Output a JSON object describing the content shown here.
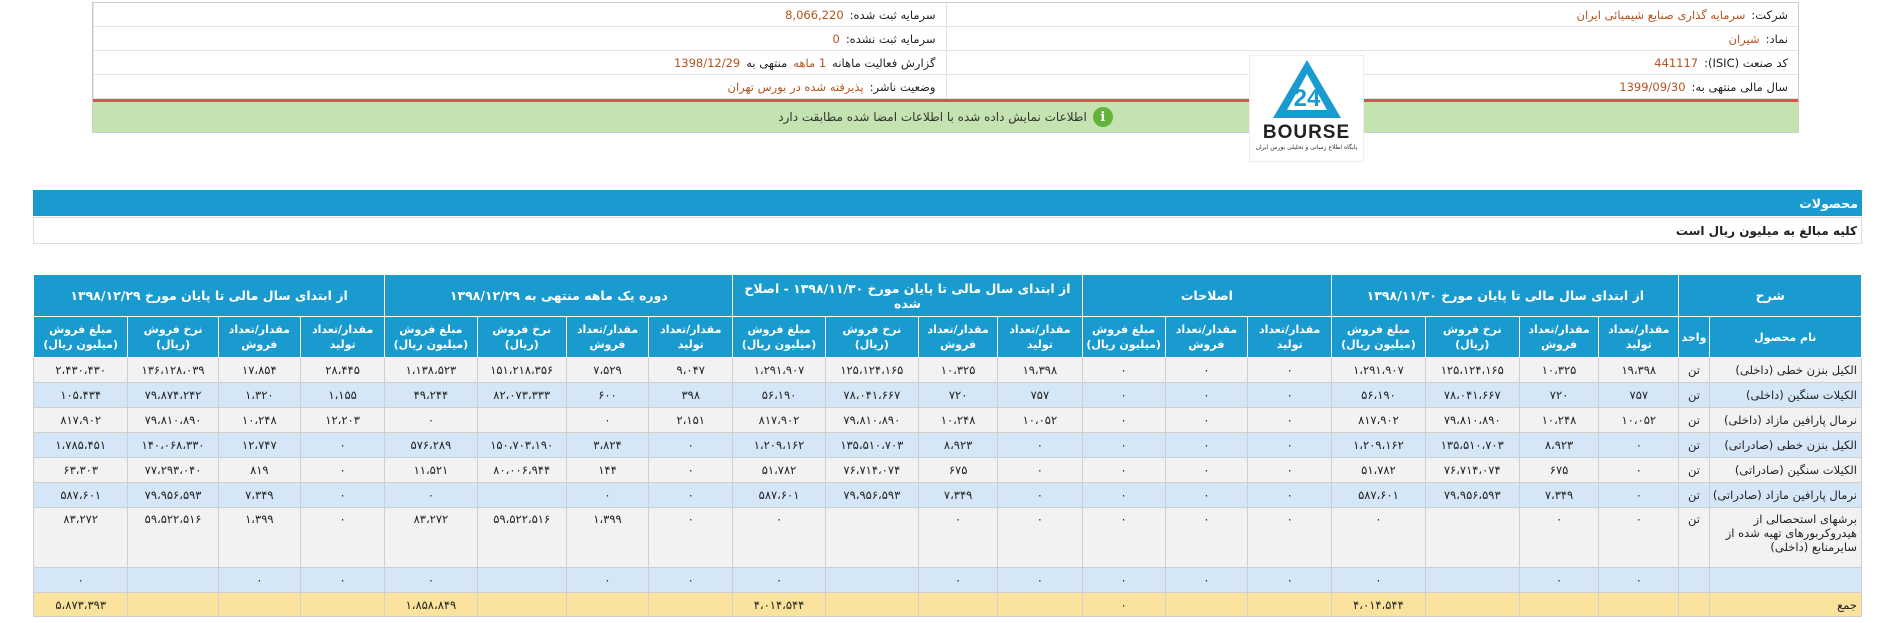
{
  "info": {
    "company_label": "شرکت:",
    "company_value": "سرمایه گذاری صنایع شیمیائی ایران",
    "capital_reg_label": "سرمایه ثبت شده:",
    "capital_reg_value": "8,066,220",
    "symbol_label": "نماد:",
    "symbol_value": "شیران",
    "capital_unreg_label": "سرمایه ثبت نشده:",
    "capital_unreg_value": "0",
    "isic_label": "کد صنعت (ISIC):",
    "isic_value": "441117",
    "report_label": "گزارش فعالیت ماهانه",
    "report_months": "1 ماهه",
    "report_mid": "منتهی به",
    "report_date": "1398/12/29",
    "fy_label": "سال مالی منتهی به:",
    "fy_value": "1399/09/30",
    "publisher_label": "وضعیت ناشر:",
    "publisher_value": "پذیرفته شده در بورس تهران",
    "banner_text": "اطلاعات نمایش داده شده با اطلاعات امضا شده مطابقت دارد",
    "banner_icon": "i"
  },
  "logo": {
    "text": "BOURSE",
    "sub": "پایگاه اطلاع رسانی و تحلیلی بورس ایران",
    "digits": "24"
  },
  "section": {
    "title": "محصولات",
    "note": "کلیه مبالغ به میلیون ریال است"
  },
  "table": {
    "groups": [
      "شرح",
      "از ابتدای سال مالی تا پایان مورخ ۱۳۹۸/۱۱/۳۰",
      "اصلاحات",
      "از ابتدای سال مالی تا پایان مورخ ۱۳۹۸/۱۱/۳۰ - اصلاح شده",
      "دوره یک ماهه منتهی به ۱۳۹۸/۱۲/۲۹",
      "از ابتدای سال مالی تا پایان مورخ ۱۳۹۸/۱۲/۲۹"
    ],
    "desc_cols": [
      "نام محصول",
      "واحد"
    ],
    "sub4": [
      "مقدار/تعداد تولید",
      "مقدار/تعداد فروش",
      "نرخ فروش (ریال)",
      "مبلغ فروش (میلیون ریال)"
    ],
    "sub3": [
      "مقدار/تعداد تولید",
      "مقدار/تعداد فروش",
      "مبلغ فروش (میلیون ریال)"
    ],
    "rows": [
      {
        "name": "الکیل بنزن خطی (داخلی)",
        "unit": "تن",
        "cells": [
          "۱۹،۳۹۸",
          "۱۰،۳۲۵",
          "۱۲۵،۱۲۴،۱۶۵",
          "۱،۲۹۱،۹۰۷",
          "۰",
          "۰",
          "۰",
          "۱۹،۳۹۸",
          "۱۰،۳۲۵",
          "۱۲۵،۱۲۴،۱۶۵",
          "۱،۲۹۱،۹۰۷",
          "۹،۰۴۷",
          "۷،۵۲۹",
          "۱۵۱،۲۱۸،۳۵۶",
          "۱،۱۳۸،۵۲۳",
          "۲۸،۴۴۵",
          "۱۷،۸۵۴",
          "۱۳۶،۱۲۸،۰۳۹",
          "۲،۴۳۰،۴۳۰"
        ]
      },
      {
        "name": "الکیلات سنگین (داخلی)",
        "unit": "تن",
        "cells": [
          "۷۵۷",
          "۷۲۰",
          "۷۸،۰۴۱،۶۶۷",
          "۵۶،۱۹۰",
          "۰",
          "۰",
          "۰",
          "۷۵۷",
          "۷۲۰",
          "۷۸،۰۴۱،۶۶۷",
          "۵۶،۱۹۰",
          "۳۹۸",
          "۶۰۰",
          "۸۲،۰۷۳،۳۳۳",
          "۴۹،۲۴۴",
          "۱،۱۵۵",
          "۱،۳۲۰",
          "۷۹،۸۷۴،۲۴۲",
          "۱۰۵،۴۳۴"
        ]
      },
      {
        "name": "نرمال پارافین مازاد (داخلی)",
        "unit": "تن",
        "cells": [
          "۱۰،۰۵۲",
          "۱۰،۲۴۸",
          "۷۹،۸۱۰،۸۹۰",
          "۸۱۷،۹۰۲",
          "۰",
          "۰",
          "۰",
          "۱۰،۰۵۲",
          "۱۰،۲۴۸",
          "۷۹،۸۱۰،۸۹۰",
          "۸۱۷،۹۰۲",
          "۲،۱۵۱",
          "۰",
          "",
          "۰",
          "۱۲،۲۰۳",
          "۱۰،۲۴۸",
          "۷۹،۸۱۰،۸۹۰",
          "۸۱۷،۹۰۲"
        ]
      },
      {
        "name": "الکیل بنزن خطی (صادراتی)",
        "unit": "تن",
        "cells": [
          "۰",
          "۸،۹۲۳",
          "۱۳۵،۵۱۰،۷۰۳",
          "۱،۲۰۹،۱۶۲",
          "۰",
          "۰",
          "۰",
          "۰",
          "۸،۹۲۳",
          "۱۳۵،۵۱۰،۷۰۳",
          "۱،۲۰۹،۱۶۲",
          "۰",
          "۳،۸۲۴",
          "۱۵۰،۷۰۳،۱۹۰",
          "۵۷۶،۲۸۹",
          "۰",
          "۱۲،۷۴۷",
          "۱۴۰،۰۶۸،۳۳۰",
          "۱،۷۸۵،۴۵۱"
        ]
      },
      {
        "name": "الکیلات سنگین (صادراتی)",
        "unit": "تن",
        "cells": [
          "۰",
          "۶۷۵",
          "۷۶،۷۱۴،۰۷۴",
          "۵۱،۷۸۲",
          "۰",
          "۰",
          "۰",
          "۰",
          "۶۷۵",
          "۷۶،۷۱۴،۰۷۴",
          "۵۱،۷۸۲",
          "۰",
          "۱۴۴",
          "۸۰،۰۰۶،۹۴۴",
          "۱۱،۵۲۱",
          "۰",
          "۸۱۹",
          "۷۷،۲۹۳،۰۴۰",
          "۶۳،۳۰۳"
        ]
      },
      {
        "name": "نرمال پارافین مازاد (صادراتی)",
        "unit": "تن",
        "cells": [
          "۰",
          "۷،۳۴۹",
          "۷۹،۹۵۶،۵۹۳",
          "۵۸۷،۶۰۱",
          "۰",
          "۰",
          "۰",
          "۰",
          "۷،۳۴۹",
          "۷۹،۹۵۶،۵۹۳",
          "۵۸۷،۶۰۱",
          "۰",
          "۰",
          "",
          "۰",
          "۰",
          "۷،۳۴۹",
          "۷۹،۹۵۶،۵۹۳",
          "۵۸۷،۶۰۱"
        ]
      },
      {
        "name": "برشهای استحصالی از هیدروکربورهای تهیه شده از سایرمنابع (داخلی)",
        "unit": "تن",
        "cells": [
          "۰",
          "۰",
          "",
          "۰",
          "۰",
          "۰",
          "۰",
          "۰",
          "۰",
          "",
          "۰",
          "۰",
          "۱،۳۹۹",
          "۵۹،۵۲۲،۵۱۶",
          "۸۳،۲۷۲",
          "۰",
          "۱،۳۹۹",
          "۵۹،۵۲۲،۵۱۶",
          "۸۳،۲۷۲"
        ]
      },
      {
        "name": "",
        "unit": "",
        "cells": [
          "۰",
          "۰",
          "",
          "۰",
          "۰",
          "۰",
          "۰",
          "۰",
          "۰",
          "",
          "۰",
          "۰",
          "۰",
          "",
          "۰",
          "۰",
          "۰",
          "",
          "۰"
        ]
      }
    ],
    "sum": {
      "label": "جمع",
      "cells": [
        "",
        "",
        "",
        "۴،۰۱۴،۵۴۴",
        "",
        "",
        "۰",
        "",
        "",
        "",
        "۴،۰۱۴،۵۴۴",
        "",
        "",
        "",
        "۱،۸۵۸،۸۴۹",
        "",
        "",
        "",
        "۵،۸۷۳،۳۹۳"
      ]
    }
  },
  "colors": {
    "header_blue": "#1a9bd0",
    "row_gray": "#f2f2f2",
    "row_blue": "#d5e6f7",
    "sum_yellow": "#fbe39d",
    "banner_green": "#c4e3b0",
    "alert_red": "#d9534f",
    "value_orange": "#b5531d"
  }
}
